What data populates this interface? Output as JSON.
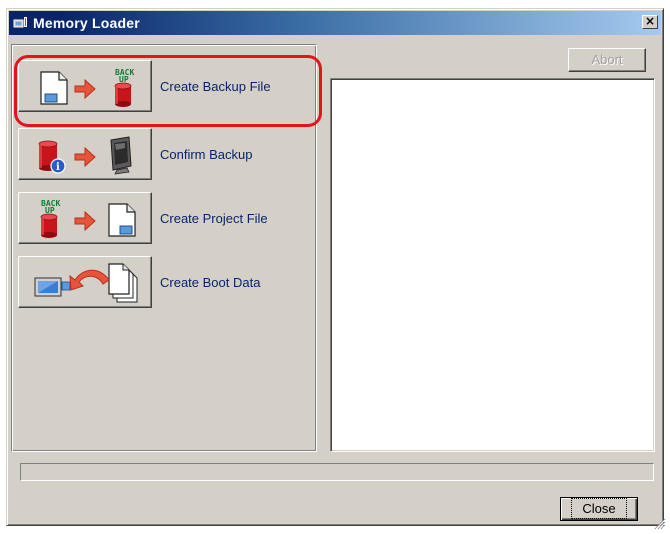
{
  "window": {
    "title": "Memory Loader",
    "close_glyph": "×"
  },
  "actions": [
    {
      "label": "Create Backup File",
      "icon": "file-to-backup-icon",
      "highlighted": true
    },
    {
      "label": "Confirm Backup",
      "icon": "backup-info-to-monitor-icon",
      "highlighted": false
    },
    {
      "label": "Create Project File",
      "icon": "backup-to-file-icon",
      "highlighted": false
    },
    {
      "label": "Create Boot Data",
      "icon": "file-to-device-icon",
      "highlighted": false
    }
  ],
  "buttons": {
    "abort": "Abort",
    "close": "Close"
  },
  "colors": {
    "highlight": "#e3141c",
    "arrow": "#e8543a",
    "cylinder": "#c8151b",
    "title_bar": "#0a246a"
  }
}
